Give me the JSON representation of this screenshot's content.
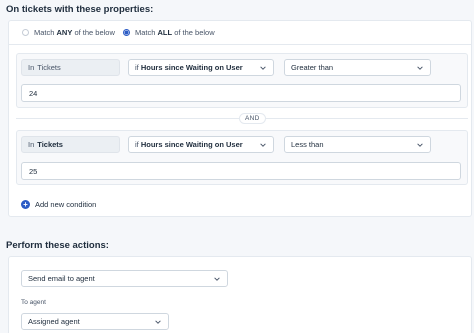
{
  "conditions_section": {
    "heading": "On tickets with these properties:",
    "match_any_prefix": "Match ",
    "match_any_emphasis": "ANY",
    "match_any_suffix": " of the below",
    "match_all_prefix": "Match ",
    "match_all_emphasis": "ALL",
    "match_all_suffix": " of the below",
    "selected_match": "all",
    "conditions": [
      {
        "scope_prefix": "In",
        "scope_value": "Tickets",
        "field_prefix": "if",
        "field_value": "Hours since Waiting on User",
        "operator": "Greater than",
        "value": "24"
      },
      {
        "scope_prefix": "In",
        "scope_value": "Tickets",
        "field_prefix": "if",
        "field_value": "Hours since Waiting on User",
        "operator": "Less than",
        "value": "25"
      }
    ],
    "joiner": "AND",
    "add_condition_label": "Add new condition",
    "add_icon_glyph": "+"
  },
  "actions_section": {
    "heading": "Perform these actions:",
    "action_value": "Send email to agent",
    "to_agent_label": "To agent",
    "agent_value": "Assigned agent"
  },
  "icons": {
    "chevron": "chevron-down-icon",
    "plus": "plus-circle-icon"
  },
  "colors": {
    "accent": "#2c5cc5",
    "background": "#f5f7fa",
    "card": "#ffffff",
    "static_field": "#ebeff3"
  }
}
